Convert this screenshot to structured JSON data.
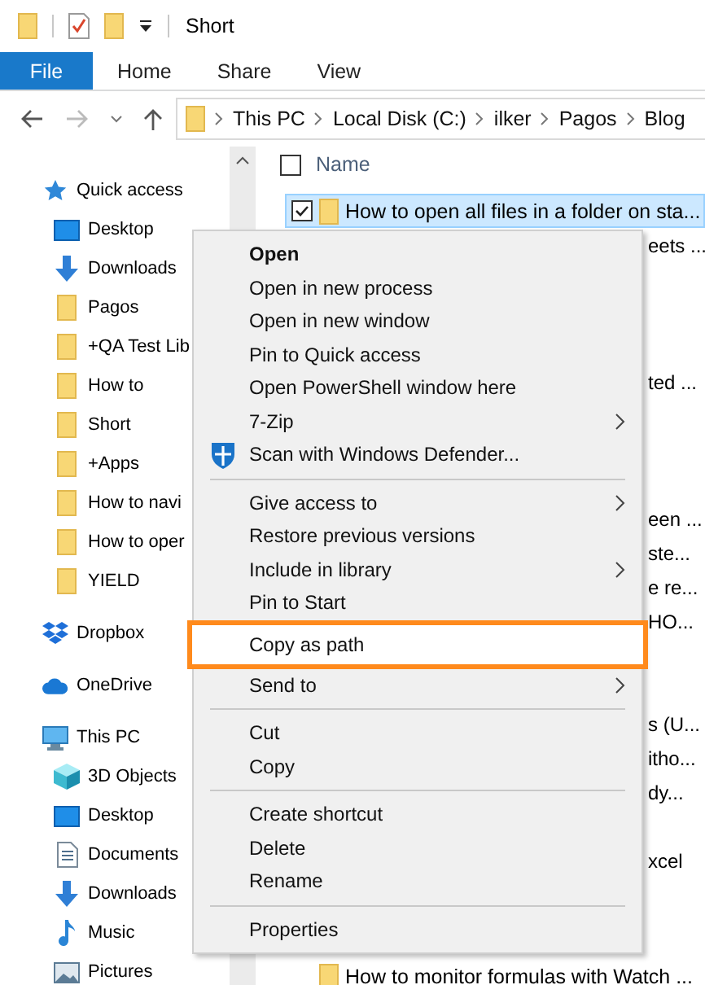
{
  "title_bar": {
    "title": "Short"
  },
  "ribbon": {
    "file_tab": "File",
    "tabs": [
      "Home",
      "Share",
      "View"
    ]
  },
  "address_bar": {
    "crumbs": [
      "This PC",
      "Local Disk (C:)",
      "ilker",
      "Pagos",
      "Blog"
    ]
  },
  "nav_pane": {
    "groups": [
      {
        "label": "Quick access",
        "kind": "star",
        "children": [
          {
            "label": "Desktop",
            "kind": "desktop"
          },
          {
            "label": "Downloads",
            "kind": "download"
          },
          {
            "label": "Pagos",
            "kind": "folder"
          },
          {
            "label": "+QA Test Lib",
            "kind": "folder"
          },
          {
            "label": "How to",
            "kind": "folder"
          },
          {
            "label": "Short",
            "kind": "folder"
          },
          {
            "label": "+Apps",
            "kind": "folder"
          },
          {
            "label": "How to navi",
            "kind": "folder"
          },
          {
            "label": "How to oper",
            "kind": "folder"
          },
          {
            "label": "YIELD",
            "kind": "folder"
          }
        ]
      },
      {
        "label": "Dropbox",
        "kind": "dropbox"
      },
      {
        "label": "OneDrive",
        "kind": "cloud"
      },
      {
        "label": "This PC",
        "kind": "pc",
        "children": [
          {
            "label": "3D Objects",
            "kind": "cube"
          },
          {
            "label": "Desktop",
            "kind": "desktop"
          },
          {
            "label": "Documents",
            "kind": "document"
          },
          {
            "label": "Downloads",
            "kind": "download"
          },
          {
            "label": "Music",
            "kind": "music"
          },
          {
            "label": "Pictures",
            "kind": "pictures"
          }
        ]
      }
    ]
  },
  "files": {
    "column": "Name",
    "select_all": {
      "checked": false
    },
    "rows": [
      {
        "name": "How to open all files in a folder on sta...",
        "selected": true
      },
      {
        "name": "eets ...",
        "selected": false
      },
      {
        "name": "ted ...",
        "selected": false
      },
      {
        "name": "een ...",
        "selected": false
      },
      {
        "name": "ste...",
        "selected": false
      },
      {
        "name": "e re...",
        "selected": false
      },
      {
        "name": "HO...",
        "selected": false
      },
      {
        "name": "s (U...",
        "selected": false
      },
      {
        "name": "itho...",
        "selected": false
      },
      {
        "name": "dy...",
        "selected": false
      },
      {
        "name": "xcel",
        "selected": false
      },
      {
        "name": "How to monitor formulas with Watch ...",
        "selected": false
      }
    ]
  },
  "context_menu": {
    "items": [
      {
        "kind": "item",
        "label": "Open",
        "default": true,
        "submenu": false,
        "highlighted": false
      },
      {
        "kind": "item",
        "label": "Open in new process",
        "default": false,
        "submenu": false,
        "highlighted": false
      },
      {
        "kind": "item",
        "label": "Open in new window",
        "default": false,
        "submenu": false,
        "highlighted": false
      },
      {
        "kind": "item",
        "label": "Pin to Quick access",
        "default": false,
        "submenu": false,
        "highlighted": false
      },
      {
        "kind": "item",
        "label": "Open PowerShell window here",
        "default": false,
        "submenu": false,
        "highlighted": false
      },
      {
        "kind": "item",
        "label": "7-Zip",
        "default": false,
        "submenu": true,
        "highlighted": false
      },
      {
        "kind": "shielded",
        "label": "Scan with Windows Defender...",
        "default": false,
        "submenu": false,
        "highlighted": false
      },
      {
        "kind": "separator"
      },
      {
        "kind": "item",
        "label": "Give access to",
        "default": false,
        "submenu": true,
        "highlighted": false
      },
      {
        "kind": "item",
        "label": "Restore previous versions",
        "default": false,
        "submenu": false,
        "highlighted": false
      },
      {
        "kind": "item",
        "label": "Include in library",
        "default": false,
        "submenu": true,
        "highlighted": false
      },
      {
        "kind": "item",
        "label": "Pin to Start",
        "default": false,
        "submenu": false,
        "highlighted": false
      },
      {
        "kind": "item",
        "label": "Copy as path",
        "default": false,
        "submenu": false,
        "highlighted": true
      },
      {
        "kind": "item",
        "label": "Send to",
        "default": false,
        "submenu": true,
        "highlighted": false
      },
      {
        "kind": "separator"
      },
      {
        "kind": "item",
        "label": "Cut",
        "default": false,
        "submenu": false,
        "highlighted": false
      },
      {
        "kind": "item",
        "label": "Copy",
        "default": false,
        "submenu": false,
        "highlighted": false
      },
      {
        "kind": "separator"
      },
      {
        "kind": "item",
        "label": "Create shortcut",
        "default": false,
        "submenu": false,
        "highlighted": false
      },
      {
        "kind": "item",
        "label": "Delete",
        "default": false,
        "submenu": false,
        "highlighted": false
      },
      {
        "kind": "item",
        "label": "Rename",
        "default": false,
        "submenu": false,
        "highlighted": false
      },
      {
        "kind": "separator"
      },
      {
        "kind": "item",
        "label": "Properties",
        "default": false,
        "submenu": false,
        "highlighted": false
      }
    ]
  }
}
